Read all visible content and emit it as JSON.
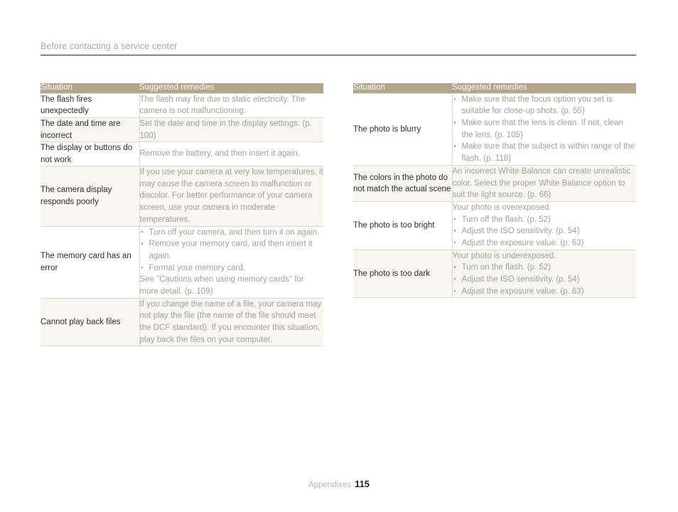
{
  "header": {
    "title": "Before contacting a service center"
  },
  "footer": {
    "section_label": "Appendixes",
    "page_number": "115"
  },
  "colors": {
    "table_header_bg": "#b3a68c",
    "table_header_text": "#ffffff",
    "row_shaded_bg": "#f8f6f1",
    "row_border": "#ded9cf",
    "situation_text": "#2e2e2e",
    "remedy_text": "#a4a09c",
    "page_rule": "#2b2b2b",
    "header_title_text": "#a9a9a9"
  },
  "tables": [
    {
      "id": "left",
      "columns": [
        "Situation",
        "Suggested remedies"
      ],
      "rows": [
        {
          "shaded": false,
          "situation": "The flash fires unexpectedly",
          "remedy": {
            "lead": "The flash may fire due to static electricity. The camera is not malfunctioning.",
            "bullets": [],
            "trail": ""
          }
        },
        {
          "shaded": true,
          "situation": "The date and time are incorrect",
          "remedy": {
            "lead": "Set the date and time in the display settings. (p. 100)",
            "bullets": [],
            "trail": ""
          }
        },
        {
          "shaded": false,
          "situation": "The display or buttons do not work",
          "remedy": {
            "lead": "Remove the battery, and then insert it again.",
            "bullets": [],
            "trail": ""
          }
        },
        {
          "shaded": true,
          "situation": "The camera display responds poorly",
          "remedy": {
            "lead": "If you use your camera at very low temperatures, it may cause the camera screen to malfunction or discolor. For better performance of your camera screen, use your camera in moderate temperatures.",
            "bullets": [],
            "trail": ""
          }
        },
        {
          "shaded": false,
          "situation": "The memory card has an error",
          "remedy": {
            "lead": "",
            "bullets": [
              "Turn off your camera, and then turn it on again.",
              "Remove your memory card, and then insert it again.",
              "Format your memory card."
            ],
            "trail": "See \"Cautions when using memory cards\" for more detail. (p. 109)"
          }
        },
        {
          "shaded": true,
          "situation": "Cannot play back files",
          "remedy": {
            "lead": "If you change the name of a file, your camera may not play the file (the name of the file should meet the DCF standard). If you encounter this situation, play back the files on your computer.",
            "bullets": [],
            "trail": ""
          }
        }
      ]
    },
    {
      "id": "right",
      "columns": [
        "Situation",
        "Suggested remedies"
      ],
      "rows": [
        {
          "shaded": false,
          "situation": "The photo is blurry",
          "remedy": {
            "lead": "",
            "bullets": [
              "Make sure that the focus option you set is suitable for close-up shots. (p. 55)",
              "Make sure that the lens is clean. If not, clean the lens. (p. 105)",
              "Make sure that the subject is within range of the flash. (p. 118)"
            ],
            "trail": ""
          }
        },
        {
          "shaded": true,
          "situation": "The colors in the photo do not match the actual scene",
          "remedy": {
            "lead": "An incorrect White Balance can create unrealistic color. Select the proper White Balance option to suit the light source. (p. 66)",
            "bullets": [],
            "trail": ""
          }
        },
        {
          "shaded": false,
          "situation": "The photo is too bright",
          "remedy": {
            "lead": "Your photo is overexposed.",
            "bullets": [
              "Turn off the flash. (p. 52)",
              "Adjust the ISO sensitivity. (p. 54)",
              "Adjust the exposure value. (p. 63)"
            ],
            "trail": ""
          }
        },
        {
          "shaded": true,
          "situation": "The photo is too dark",
          "remedy": {
            "lead": "Your photo is underexposed.",
            "bullets": [
              "Turn on the flash. (p. 52)",
              "Adjust the ISO sensitivity. (p. 54)",
              "Adjust the exposure value. (p. 63)"
            ],
            "trail": ""
          }
        }
      ]
    }
  ]
}
